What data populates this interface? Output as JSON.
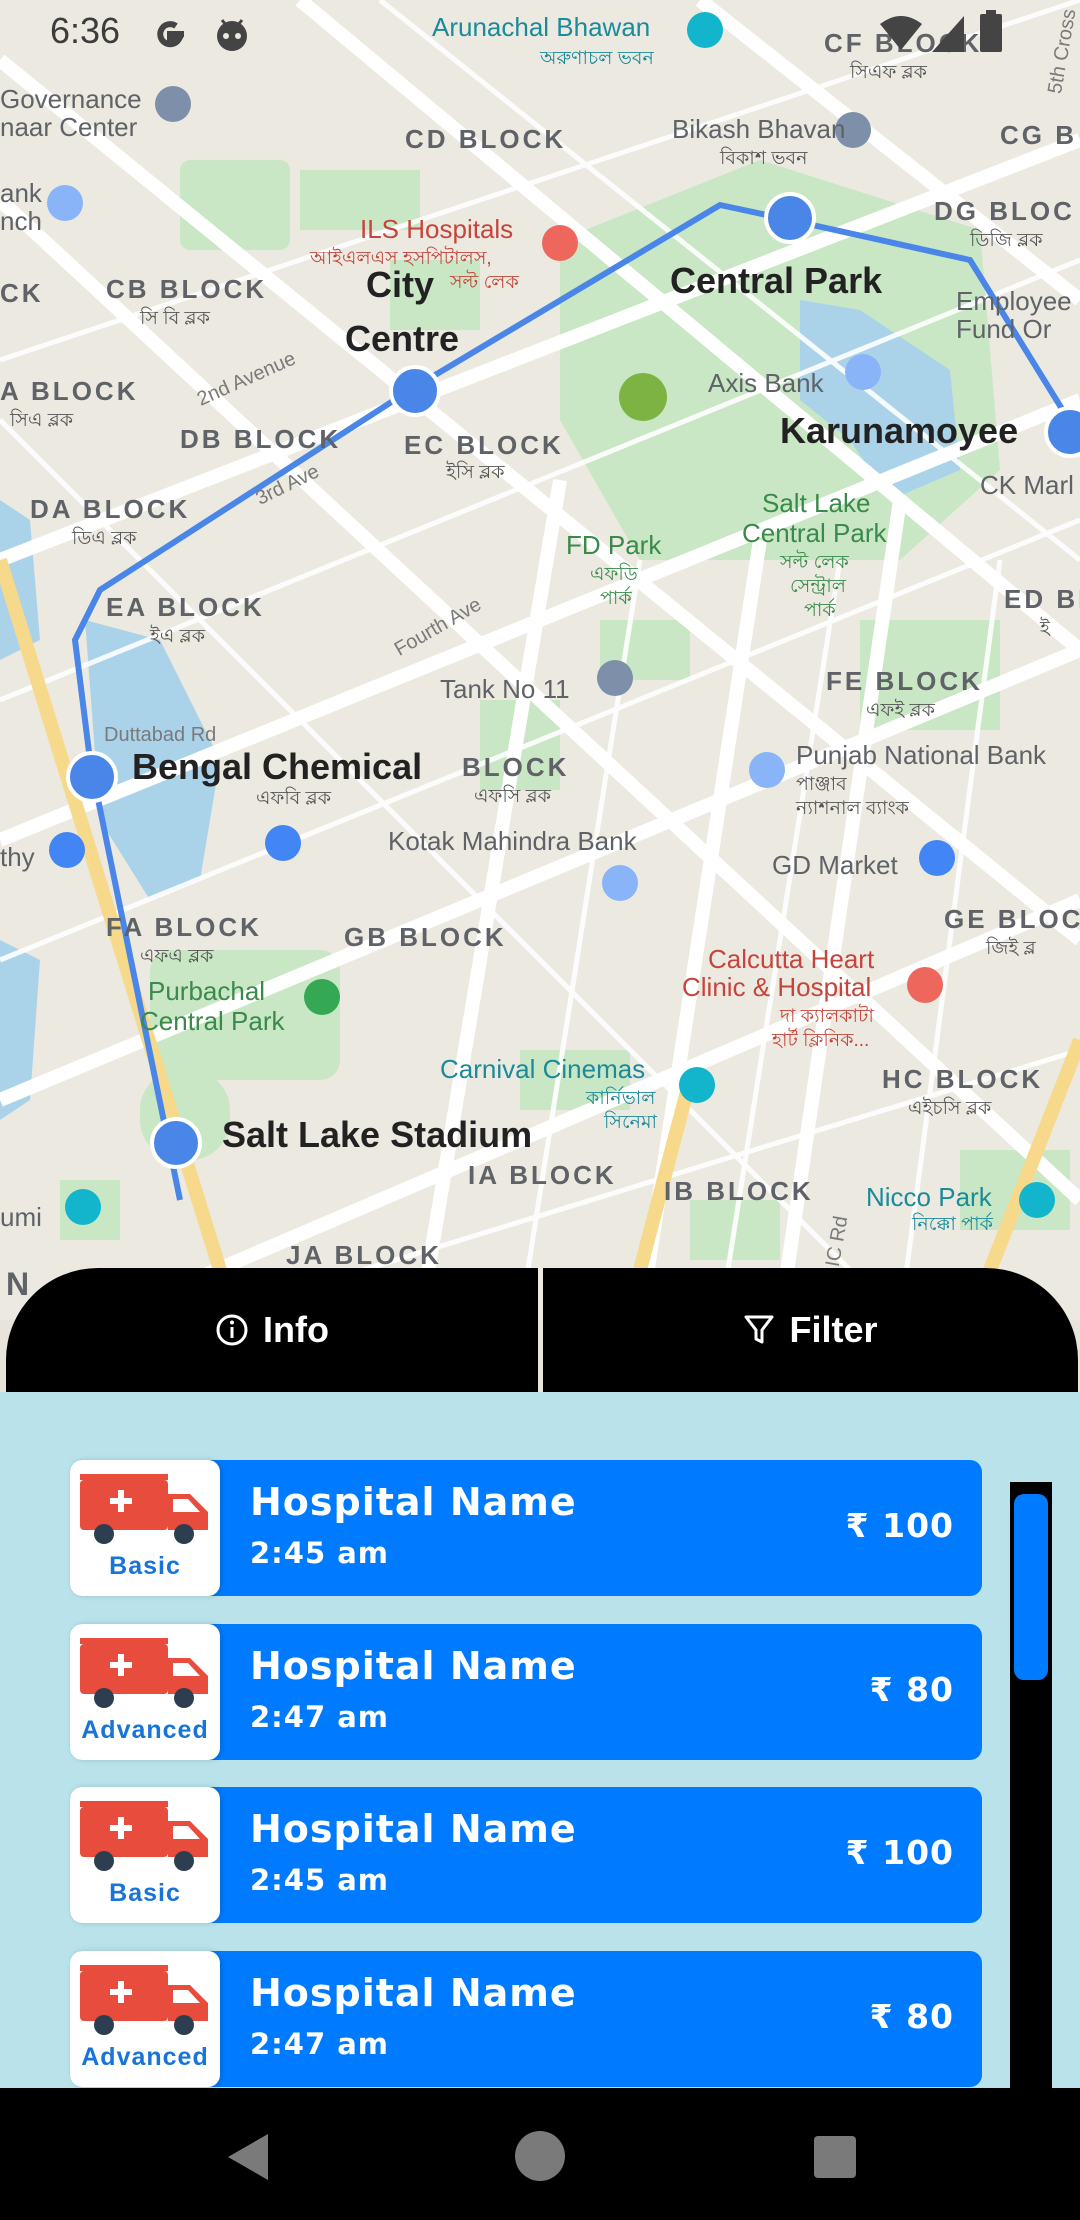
{
  "status_bar": {
    "time": "6:36",
    "left_icons": [
      "google-g-icon",
      "android-icon"
    ],
    "right_icons": [
      "wifi-icon",
      "signal-icon",
      "battery-icon"
    ]
  },
  "map": {
    "labels": {
      "arunachal_bhawan": "Arunachal Bhawan",
      "arunachal_bhawan_bn": "অরুণাচল ভবন",
      "cf_block": "CF BLOCK",
      "cf_block_bn": "সিএফ ব্লক",
      "governance_1": "Governance",
      "governance_2": "naar Center",
      "cd_block": "CD BLOCK",
      "bikash_bhavan": "Bikash Bhavan",
      "bikash_bhavan_bn": "বিকাশ ভবন",
      "cg_block": "CG B",
      "bank_1": "ank",
      "bank_2": "nch",
      "ils_hospitals": "ILS Hospitals",
      "ils_hospitals_bn_1": "আইএলএস হসপিটালস,",
      "ils_hospitals_bn_2": "সল্ট লেক",
      "dg_block": "DG BLOC",
      "dg_block_bn": "ডিজি ব্লক",
      "ck_left": "CK",
      "cb_block": "CB BLOCK",
      "cb_block_bn": "সি বি ব্লক",
      "city_1": "City",
      "city_2": "Centre",
      "central_park": "Central Park",
      "employee_1": "Employee",
      "employee_2": "Fund Or",
      "axis_bank": "Axis Bank",
      "a_block": "A BLOCK",
      "a_block_bn": "সিএ ব্লক",
      "second_avenue": "2nd Avenue",
      "karunamoyee": "Karunamoyee",
      "db_block": "DB BLOCK",
      "ec_block": "EC BLOCK",
      "ec_block_bn": "ইসি ব্লক",
      "ck_market": "CK Marl",
      "third_avenue": "3rd Ave",
      "da_block": "DA BLOCK",
      "da_block_bn": "ডিএ ব্লক",
      "salt_lake_cp_1": "Salt Lake",
      "salt_lake_cp_2": "Central Park",
      "salt_lake_cp_bn_1": "সল্ট লেক",
      "salt_lake_cp_bn_2": "সেন্ট্রাল",
      "salt_lake_cp_bn_3": "পার্ক",
      "fd_park": "FD Park",
      "fd_park_bn_1": "এফডি",
      "fd_park_bn_2": "পার্ক",
      "ed_block": "ED BL",
      "ed_block_bn": "ই",
      "ea_block": "EA BLOCK",
      "ea_block_bn": "ইএ ব্লক",
      "fourth_ave": "Fourth Ave",
      "tank_no_11": "Tank No 11",
      "fe_block": "FE BLOCK",
      "fe_block_bn": "এফই ব্লক",
      "duttabad_rd": "Duttabad Rd",
      "bengal_chemical": "Bengal Chemical",
      "bengal_chemical_bn": "এফবি ব্লক",
      "block": "BLOCK",
      "block_bn": "এফসি ব্লক",
      "punjab_national": "Punjab National Bank",
      "punjab_national_bn_1": "পাঞ্জাব",
      "punjab_national_bn_2": "ন্যাশনাল ব্যাংক",
      "thy": "thy",
      "kotak": "Kotak Mahindra Bank",
      "gd_market": "GD Market",
      "fa_block": "FA BLOCK",
      "fa_block_bn": "এফএ ব্লক",
      "gb_block": "GB BLOCK",
      "ge_block": "GE BLOC",
      "ge_block_bn": "জিই ব্ল",
      "calcutta_heart_1": "Calcutta Heart",
      "calcutta_heart_2": "Clinic & Hospital",
      "calcutta_heart_bn_1": "দা ক্যালকাটা",
      "calcutta_heart_bn_2": "হার্ট ক্লিনিক...",
      "purbachal_1": "Purbachal",
      "purbachal_2": "Central Park",
      "carnival_1": "Carnival Cinemas",
      "carnival_bn_1": "কার্নিভাল",
      "carnival_bn_2": "সিনেমা",
      "hc_block": "HC BLOCK",
      "hc_block_bn": "এইচসি ব্লক",
      "salt_lake_stadium": "Salt Lake Stadium",
      "ia_block": "IA BLOCK",
      "ib_block": "IB BLOCK",
      "nicco_park": "Nicco Park",
      "nicco_park_bn": "নিক্কো পার্ক",
      "umi": "umi",
      "ja_block": "JA BLOCK",
      "n_left": "N",
      "fifth_cross": "5th Cross",
      "ic_rd": "IC Rd"
    }
  },
  "tabs": {
    "info_label": "Info",
    "filter_label": "Filter"
  },
  "hospitals": [
    {
      "type": "Basic",
      "name": "Hospital Name",
      "time": "2:45 am",
      "price": "₹ 100"
    },
    {
      "type": "Advanced",
      "name": "Hospital Name",
      "time": "2:47 am",
      "price": "₹ 80"
    },
    {
      "type": "Basic",
      "name": "Hospital Name",
      "time": "2:45 am",
      "price": "₹ 100"
    },
    {
      "type": "Advanced",
      "name": "Hospital Name",
      "time": "2:47 am",
      "price": "₹ 80"
    }
  ],
  "colors": {
    "card_blue": "#007bff",
    "panel_bg": "#b9e2ea",
    "tab_bg": "#000000",
    "metro_route": "#4a86e8",
    "ambulance_red": "#e74c3c"
  }
}
